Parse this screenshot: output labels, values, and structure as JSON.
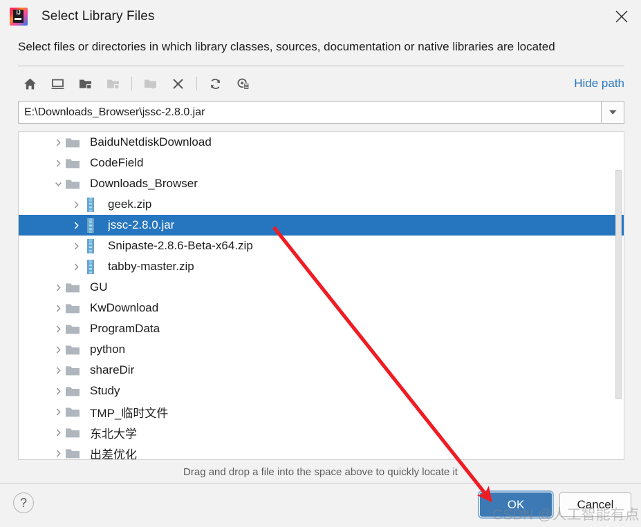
{
  "window": {
    "title": "Select Library Files",
    "app_icon": "intellij-idea-logo",
    "close_icon": "close-icon"
  },
  "description": "Select files or directories in which library classes, sources, documentation or native libraries are located",
  "toolbar": {
    "buttons": [
      {
        "name": "home-icon",
        "tooltip": "Home",
        "enabled": true
      },
      {
        "name": "desktop-icon",
        "tooltip": "Desktop",
        "enabled": true
      },
      {
        "name": "folder-project-icon",
        "tooltip": "Project Directory",
        "enabled": true
      },
      {
        "name": "folder-module-icon",
        "tooltip": "Module Directory",
        "enabled": false
      },
      {
        "name": "new-folder-icon",
        "tooltip": "New Folder",
        "enabled": false
      },
      {
        "name": "delete-icon",
        "tooltip": "Delete",
        "enabled": true
      },
      {
        "name": "refresh-icon",
        "tooltip": "Refresh",
        "enabled": true
      },
      {
        "name": "show-hidden-icon",
        "tooltip": "Show Hidden Files",
        "enabled": true
      }
    ],
    "hide_path_label": "Hide path"
  },
  "path": {
    "value": "E:\\Downloads_Browser\\jssc-2.8.0.jar",
    "dropdown_icon": "chevron-down-icon"
  },
  "tree": {
    "rows": [
      {
        "label": "BaiduNetdiskDownload",
        "indent": 1,
        "icon": "folder-icon",
        "expander": "chevron-right-icon",
        "selected": false
      },
      {
        "label": "CodeField",
        "indent": 1,
        "icon": "folder-icon",
        "expander": "chevron-right-icon",
        "selected": false
      },
      {
        "label": "Downloads_Browser",
        "indent": 1,
        "icon": "folder-icon",
        "expander": "chevron-down-icon",
        "selected": false
      },
      {
        "label": "geek.zip",
        "indent": 2,
        "icon": "archive-icon",
        "expander": "chevron-right-icon",
        "selected": false
      },
      {
        "label": "jssc-2.8.0.jar",
        "indent": 2,
        "icon": "archive-icon",
        "expander": "chevron-right-icon",
        "selected": true
      },
      {
        "label": "Snipaste-2.8.6-Beta-x64.zip",
        "indent": 2,
        "icon": "archive-icon",
        "expander": "chevron-right-icon",
        "selected": false
      },
      {
        "label": "tabby-master.zip",
        "indent": 2,
        "icon": "archive-icon",
        "expander": "chevron-right-icon",
        "selected": false
      },
      {
        "label": "GU",
        "indent": 1,
        "icon": "folder-icon",
        "expander": "chevron-right-icon",
        "selected": false
      },
      {
        "label": "KwDownload",
        "indent": 1,
        "icon": "folder-icon",
        "expander": "chevron-right-icon",
        "selected": false
      },
      {
        "label": "ProgramData",
        "indent": 1,
        "icon": "folder-icon",
        "expander": "chevron-right-icon",
        "selected": false
      },
      {
        "label": "python",
        "indent": 1,
        "icon": "folder-icon",
        "expander": "chevron-right-icon",
        "selected": false
      },
      {
        "label": "shareDir",
        "indent": 1,
        "icon": "folder-icon",
        "expander": "chevron-right-icon",
        "selected": false
      },
      {
        "label": "Study",
        "indent": 1,
        "icon": "folder-icon",
        "expander": "chevron-right-icon",
        "selected": false
      },
      {
        "label": "TMP_临时文件",
        "indent": 1,
        "icon": "folder-icon",
        "expander": "chevron-right-icon",
        "selected": false
      },
      {
        "label": "东北大学",
        "indent": 1,
        "icon": "folder-icon",
        "expander": "chevron-right-icon",
        "selected": false
      },
      {
        "label": "出差优化",
        "indent": 1,
        "icon": "folder-icon",
        "expander": "chevron-right-icon",
        "selected": false
      },
      {
        "label": "",
        "indent": 1,
        "icon": "folder-icon",
        "expander": "chevron-right-icon",
        "selected": false
      }
    ]
  },
  "hint": "Drag and drop a file into the space above to quickly locate it",
  "footer": {
    "help_label": "?",
    "ok_label": "OK",
    "cancel_label": "Cancel"
  },
  "watermark": "CSDN @人工智能有点",
  "colors": {
    "selection_blue": "#2675bf",
    "link_blue": "#2a7ac0",
    "ok_button_blue": "#3d7ab5",
    "annotation_red": "#ef1c24",
    "folder_gray": "#b0b6bd",
    "archive_blue": "#3aa6dd",
    "dialog_bg": "#f2f2f2"
  }
}
